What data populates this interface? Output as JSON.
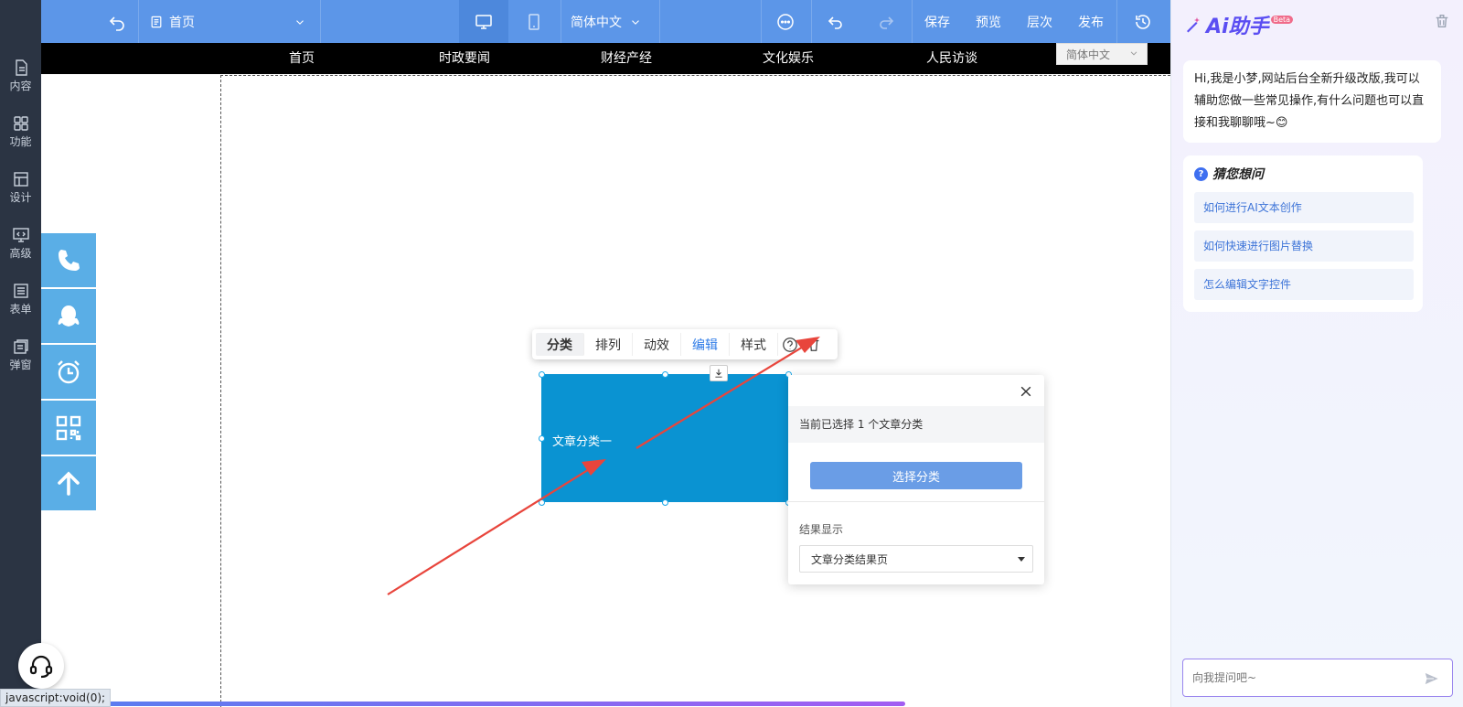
{
  "left_rail": {
    "items": [
      {
        "label": "内容",
        "icon": "file-icon"
      },
      {
        "label": "功能",
        "icon": "grid-icon"
      },
      {
        "label": "设计",
        "icon": "layout-icon"
      },
      {
        "label": "高级",
        "icon": "code-monitor-icon"
      },
      {
        "label": "表单",
        "icon": "list-form-icon"
      },
      {
        "label": "弹窗",
        "icon": "popup-icon"
      }
    ]
  },
  "topbar": {
    "page_select": "首页",
    "language": "简体中文",
    "save": "保存",
    "preview": "预览",
    "layers": "层次",
    "publish": "发布"
  },
  "site_nav": {
    "links": [
      "首页",
      "时政要闻",
      "财经产经",
      "文化娱乐",
      "人民访谈"
    ],
    "lang_box": "简体中文"
  },
  "float_bar": {
    "items": [
      "phone-icon",
      "qq-icon",
      "alarm-icon",
      "qrcode-icon",
      "arrow-up-icon"
    ]
  },
  "component_toolbar": {
    "tabs": [
      "分类",
      "排列",
      "动效",
      "编辑",
      "样式"
    ],
    "active": "分类"
  },
  "component": {
    "label": "文章分类一",
    "bg_color": "#0a93d2"
  },
  "settings_panel": {
    "info": "当前已选择 1 个文章分类",
    "choose_button": "选择分类",
    "result_label": "结果显示",
    "result_select": "文章分类结果页"
  },
  "status": {
    "url": "javascript:void(0);"
  },
  "ai": {
    "logo_text": "Ai助手",
    "beta": "Beta",
    "greeting": "Hi,我是小梦,网站后台全新升级改版,我可以辅助您做一些常见操作,有什么问题也可以直接和我聊聊哦~😊",
    "suggest_title": "猜您想问",
    "questions": [
      "如何进行AI文本创作",
      "如何快速进行图片替换",
      "怎么编辑文字控件"
    ],
    "input_placeholder": "向我提问吧~"
  },
  "colors": {
    "topbar": "#5c96e8",
    "rail": "#2b3443",
    "arrow": "#e8453c",
    "accent": "#2f7ce8"
  }
}
